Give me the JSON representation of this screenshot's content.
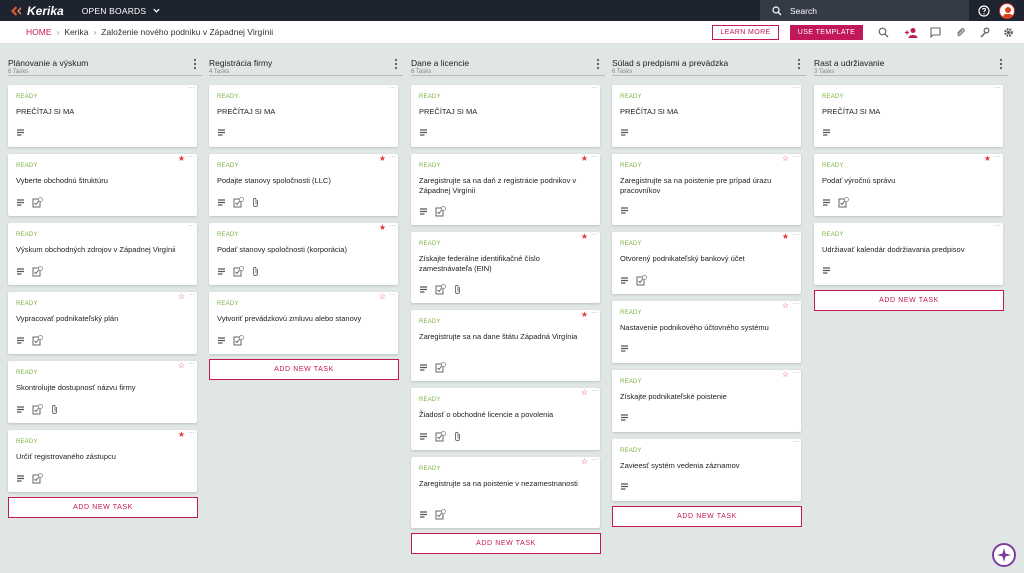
{
  "app": {
    "logo_text": "Kerika",
    "open_boards_label": "OPEN BOARDS"
  },
  "search": {
    "placeholder": "Search"
  },
  "breadcrumb": {
    "home": "HOME",
    "level1": "Kerika",
    "current": "Založenie nového podniku v Západnej Virgínii"
  },
  "toolbar": {
    "learn_more": "LEARN MORE",
    "use_template": "USE TEMPLATE"
  },
  "colors": {
    "accent": "#c2185b",
    "status_ready": "#7cb342",
    "topbar": "#1e2330",
    "star": "#e53935"
  },
  "icons": [
    "search-icon",
    "add-person-icon",
    "chat-icon",
    "attachment-icon",
    "wrench-icon",
    "gear-icon",
    "help-icon"
  ],
  "add_task_label": "ADD NEW TASK",
  "columns": [
    {
      "title": "Plánovanie a výskum",
      "count": "6 Tasks",
      "cards": [
        {
          "status": "READY",
          "title": "PREČÍTAJ SI MA",
          "star": "none",
          "checklist": false,
          "attachment": false
        },
        {
          "status": "READY",
          "title": "Vyberte obchodnú štruktúru",
          "star": "filled",
          "checklist": true,
          "attachment": false
        },
        {
          "status": "READY",
          "title": "Výskum obchodných zdrojov v Západnej Virgínii",
          "star": "none",
          "checklist": true,
          "attachment": false
        },
        {
          "status": "READY",
          "title": "Vypracovať podnikateľský plán",
          "star": "empty",
          "checklist": true,
          "attachment": false
        },
        {
          "status": "READY",
          "title": "Skontrolujte dostupnosť názvu firmy",
          "star": "empty",
          "checklist": true,
          "attachment": true
        },
        {
          "status": "READY",
          "title": "Určiť registrovaného zástupcu",
          "star": "filled",
          "checklist": true,
          "attachment": false
        }
      ]
    },
    {
      "title": "Registrácia firmy",
      "count": "4 Tasks",
      "cards": [
        {
          "status": "READY",
          "title": "PREČÍTAJ SI MA",
          "star": "none",
          "checklist": false,
          "attachment": false
        },
        {
          "status": "READY",
          "title": "Podajte stanovy spoločnosti (LLC)",
          "star": "filled",
          "checklist": true,
          "attachment": true
        },
        {
          "status": "READY",
          "title": "Podať stanovy spoločnosti (korporácia)",
          "star": "filled",
          "checklist": true,
          "attachment": true
        },
        {
          "status": "READY",
          "title": "Vytvoriť prevádzkovú zmluvu alebo stanovy",
          "star": "empty",
          "checklist": true,
          "attachment": false
        }
      ]
    },
    {
      "title": "Dane a licencie",
      "count": "6 Tasks",
      "cards": [
        {
          "status": "READY",
          "title": "PREČÍTAJ SI MA",
          "star": "none",
          "checklist": false,
          "attachment": false
        },
        {
          "status": "READY",
          "title": "Zaregistrujte sa na daň z registrácie podnikov v Západnej Virgínii",
          "star": "filled",
          "checklist": true,
          "attachment": false
        },
        {
          "status": "READY",
          "title": "Získajte federálne identifikačné číslo zamestnávateľa (EIN)",
          "star": "filled",
          "checklist": true,
          "attachment": true
        },
        {
          "status": "READY",
          "title": "Zaregistrujte sa na dane štátu Západná Virgínia",
          "star": "filled",
          "checklist": true,
          "attachment": false
        },
        {
          "status": "READY",
          "title": "Žiadosť o obchodné licencie a povolenia",
          "star": "empty",
          "checklist": true,
          "attachment": true
        },
        {
          "status": "READY",
          "title": "Zaregistrujte sa na poistenie v nezamestnanosti",
          "star": "empty",
          "checklist": true,
          "attachment": false
        }
      ]
    },
    {
      "title": "Súlad s predpismi a prevádzka",
      "count": "6 Tasks",
      "cards": [
        {
          "status": "READY",
          "title": "PREČÍTAJ SI MA",
          "star": "none",
          "checklist": false,
          "attachment": false
        },
        {
          "status": "READY",
          "title": "Zaregistrujte sa na poistenie pre prípad úrazu pracovníkov",
          "star": "empty",
          "checklist": false,
          "attachment": false
        },
        {
          "status": "READY",
          "title": "Otvorený podnikateľský bankový účet",
          "star": "filled",
          "checklist": true,
          "attachment": false
        },
        {
          "status": "READY",
          "title": "Nastavenie podnikového účtovného systému",
          "star": "empty",
          "checklist": false,
          "attachment": false
        },
        {
          "status": "READY",
          "title": "Získajte podnikateľské poistenie",
          "star": "empty",
          "checklist": false,
          "attachment": false
        },
        {
          "status": "READY",
          "title": "Zavieesť systém vedenia záznamov",
          "star": "none",
          "checklist": false,
          "attachment": false
        }
      ]
    },
    {
      "title": "Rast a udržiavanie",
      "count": "3 Tasks",
      "cards": [
        {
          "status": "READY",
          "title": "PREČÍTAJ SI MA",
          "star": "none",
          "checklist": false,
          "attachment": false
        },
        {
          "status": "READY",
          "title": "Podať výročnú správu",
          "star": "filled",
          "checklist": true,
          "attachment": false
        },
        {
          "status": "READY",
          "title": "Udržiavať kalendár dodržiavania predpisov",
          "star": "none",
          "checklist": false,
          "attachment": false
        }
      ]
    }
  ]
}
